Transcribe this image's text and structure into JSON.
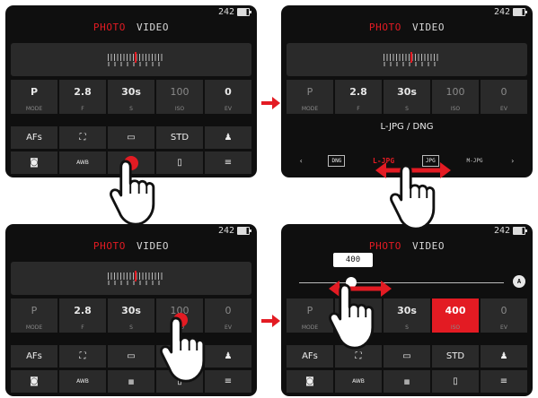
{
  "status": {
    "shots_remaining": "242"
  },
  "tabs": {
    "photo": "PHOTO",
    "video": "VIDEO"
  },
  "params": [
    {
      "value": "P",
      "label": "MODE"
    },
    {
      "value": "2.8",
      "label": "F"
    },
    {
      "value": "30s",
      "label": "S"
    },
    {
      "value": "100",
      "label": "ISO"
    },
    {
      "value": "0",
      "label": "EV"
    }
  ],
  "row1": {
    "af": "AFs",
    "std": "STD"
  },
  "format": {
    "current": "L-JPG / DNG",
    "dng": "DNG",
    "ljpg": "L-JPG",
    "jpg": "JPG",
    "mjpg": "M-JPG"
  },
  "iso_slider": {
    "value": "400",
    "auto": "A",
    "active_param_value": "400"
  },
  "colors": {
    "accent": "#e31b23",
    "screen_bg": "#0f0f0f",
    "tile_bg": "#2a2a2a"
  },
  "icons": [
    "exposure-meter-icon",
    "af-field-icon",
    "drive-mode-icon",
    "person-icon",
    "metering-icon",
    "wb-icon",
    "format-icon",
    "phone-icon",
    "menu-icon",
    "touch-hand-icon",
    "double-arrow-icon",
    "red-arrow-icon"
  ]
}
